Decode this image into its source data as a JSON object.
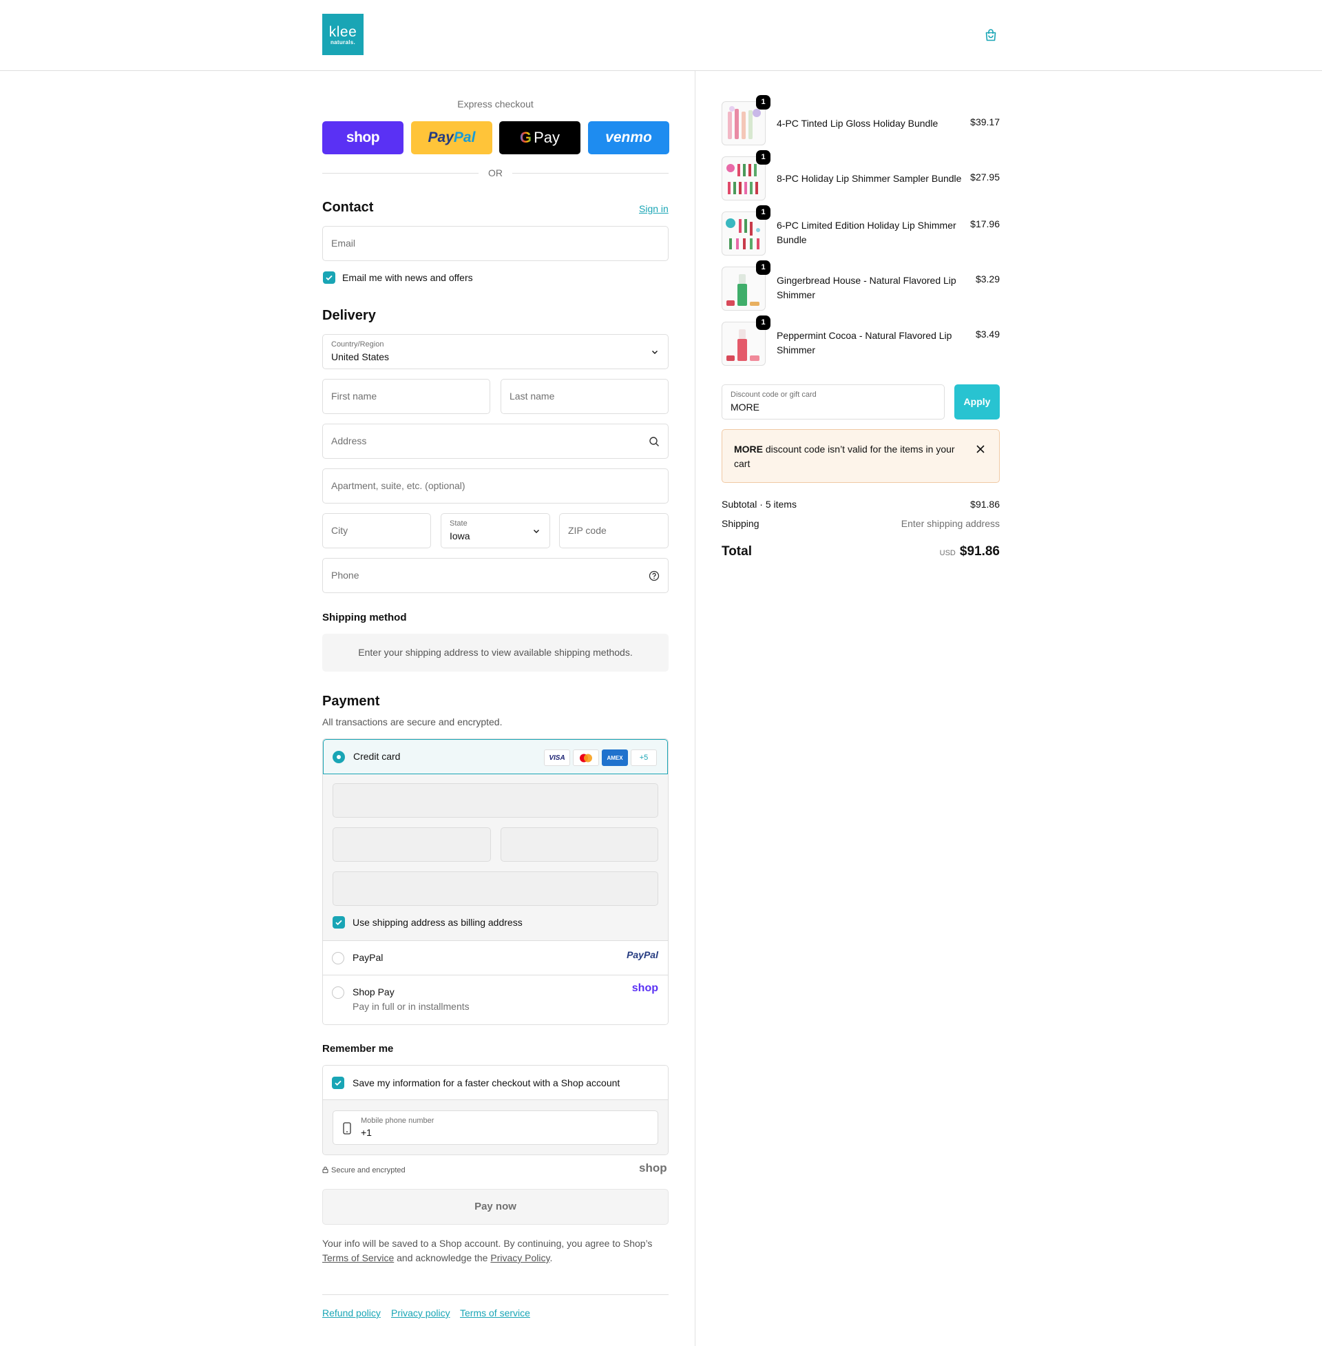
{
  "header": {
    "logo_line1": "klee",
    "logo_line2": "naturals.",
    "cart_icon": "shopping-bag-icon"
  },
  "express": {
    "label": "Express checkout",
    "buttons": {
      "shop": "shop",
      "paypal_a": "Pay",
      "paypal_b": "Pal",
      "gpay_g": "G",
      "gpay_text": "Pay",
      "venmo": "venmo"
    },
    "or": "OR"
  },
  "contact": {
    "title": "Contact",
    "sign_in": "Sign in",
    "email_placeholder": "Email",
    "news_label": "Email me with news and offers",
    "news_checked": true
  },
  "delivery": {
    "title": "Delivery",
    "country_label": "Country/Region",
    "country_value": "United States",
    "first_name": "First name",
    "last_name": "Last name",
    "address": "Address",
    "apartment": "Apartment, suite, etc. (optional)",
    "city": "City",
    "state_label": "State",
    "state_value": "Iowa",
    "zip": "ZIP code",
    "phone": "Phone"
  },
  "shipping_method": {
    "title": "Shipping method",
    "info": "Enter your shipping address to view available shipping methods."
  },
  "payment": {
    "title": "Payment",
    "subtitle": "All transactions are secure and encrypted.",
    "credit_card": "Credit card",
    "cards": [
      "VISA",
      "MC",
      "AMEX",
      "+5"
    ],
    "billing_label": "Use shipping address as billing address",
    "paypal_label": "PayPal",
    "paypal_logo": "PayPal",
    "shoppay_label": "Shop Pay",
    "shoppay_sub": "Pay in full or in installments",
    "shoppay_logo": "shop"
  },
  "remember": {
    "title": "Remember me",
    "save_label": "Save my information for a faster checkout with a Shop account",
    "mobile_label": "Mobile phone number",
    "mobile_value": "+1",
    "secure": "Secure and encrypted",
    "shop_logo": "shop"
  },
  "pay_now": "Pay now",
  "legal": {
    "text1": "Your info will be saved to a Shop account. By continuing, you agree to Shop’s",
    "tos": "Terms of Service",
    "text2": "and acknowledge the",
    "privacy": "Privacy Policy",
    "period": "."
  },
  "footer": {
    "links": [
      "Refund policy",
      "Privacy policy",
      "Terms of service"
    ]
  },
  "cart": {
    "items": [
      {
        "name": "4-PC Tinted Lip Gloss Holiday Bundle",
        "price": "$39.17",
        "qty": "1"
      },
      {
        "name": "8-PC Holiday Lip Shimmer Sampler Bundle",
        "price": "$27.95",
        "qty": "1"
      },
      {
        "name": "6-PC Limited Edition Holiday Lip Shimmer Bundle",
        "price": "$17.96",
        "qty": "1"
      },
      {
        "name": "Gingerbread House - Natural Flavored Lip Shimmer",
        "price": "$3.29",
        "qty": "1"
      },
      {
        "name": "Peppermint Cocoa - Natural Flavored Lip Shimmer",
        "price": "$3.49",
        "qty": "1"
      }
    ],
    "discount_label": "Discount code or gift card",
    "discount_value": "MORE",
    "apply": "Apply",
    "warning_code": "MORE",
    "warning_text": "discount code isn’t valid for the items in your cart",
    "subtotal_label": "Subtotal · 5 items",
    "subtotal": "$91.86",
    "shipping_label": "Shipping",
    "shipping_value": "Enter shipping address",
    "total_label": "Total",
    "currency": "USD",
    "total": "$91.86"
  },
  "colors": {
    "accent": "#19a5b5",
    "shop": "#5a31f4",
    "paypal": "#ffc439",
    "venmo": "#1e8cf0"
  }
}
